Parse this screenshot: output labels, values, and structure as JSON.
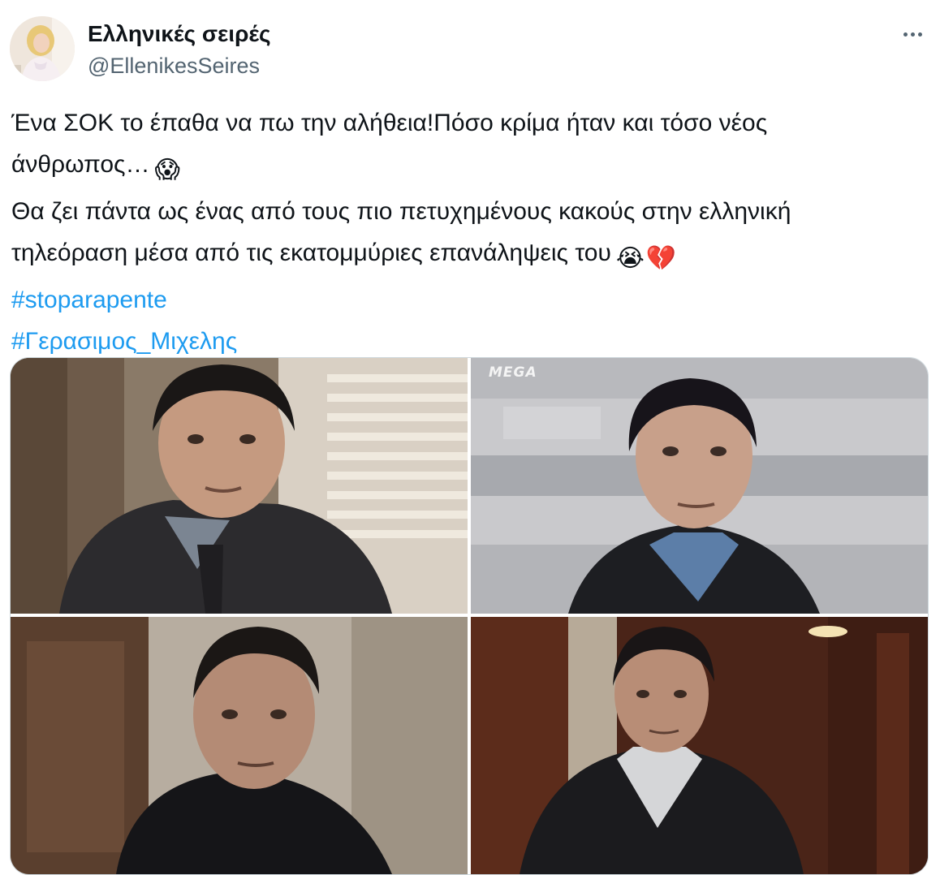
{
  "tweet": {
    "author": {
      "display_name": "Ελληνικές σειρές",
      "handle": "@EllenikesSeires",
      "avatar_icon": "profile-photo"
    },
    "more_icon": "ellipsis-icon",
    "text_lines": [
      "Ένα ΣΟΚ το έπαθα να πω την αλήθεια!Πόσο κρίμα ήταν και τόσο νέος",
      "άνθρωπος…",
      "Θα ζει πάντα ως ένας από τους πιο πετυχημένους κακούς στην ελληνική",
      "τηλεόραση μέσα από τις εκατομμύριες επανάληψεις του"
    ],
    "emojis": {
      "scream": "😱",
      "sob": "😭",
      "broken_heart": "💔"
    },
    "hashtags": [
      "#stoparapente",
      "#Γερασιμος_Μιχελης"
    ],
    "media": {
      "photos": [
        {
          "name": "photo-1"
        },
        {
          "name": "photo-2",
          "watermark": "MEGA"
        },
        {
          "name": "photo-3"
        },
        {
          "name": "photo-4"
        }
      ]
    },
    "colors": {
      "text": "#0f1419",
      "secondary": "#536471",
      "link": "#1d9bf0",
      "border": "#cfd9de"
    }
  }
}
